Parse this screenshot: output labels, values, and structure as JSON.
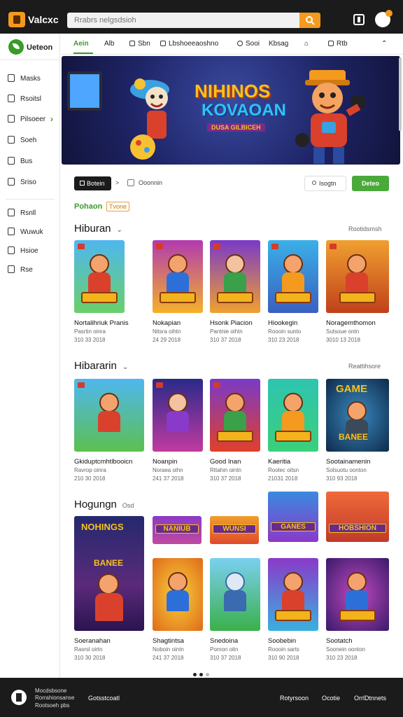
{
  "header": {
    "app_title": "Valcxc",
    "search_placeholder": "Rrabrs nelgsdsioh"
  },
  "sidebar": {
    "brand": "Ueteon",
    "items": [
      {
        "label": "Masks"
      },
      {
        "label": "Rsoitsl"
      },
      {
        "label": "Pilsoeer"
      },
      {
        "label": "Soeh"
      },
      {
        "label": "Bus"
      },
      {
        "label": "Sriso"
      },
      {
        "label": "Rsnll"
      },
      {
        "label": "Wuwuk"
      },
      {
        "label": "Hsioe"
      },
      {
        "label": "Rse"
      }
    ]
  },
  "nav": {
    "items": [
      {
        "label": "Aein",
        "active": true
      },
      {
        "label": "Alb"
      },
      {
        "label": "Sbn"
      },
      {
        "label": "Lbshoeeaoshno"
      },
      {
        "label": "Sooi"
      },
      {
        "label": "Kbsag"
      },
      {
        "label": "Rtb"
      }
    ]
  },
  "hero": {
    "title_line1": "NIHINOS",
    "title_line2": "KOVAOAN",
    "subtitle": "DUSA GILBICEH"
  },
  "toolbar": {
    "filter_label": "Botein",
    "breadcrumb_sep": ">",
    "check_label": "Ooonnin",
    "sort_label": "Isogtn",
    "action_label": "Deteo"
  },
  "popular": {
    "label": "Pohaon",
    "tag": "Tvone"
  },
  "sections": [
    {
      "title": "Hiburan",
      "link": "Rootidsmsh",
      "cards": [
        {
          "title": "Nortalihriuk Pranis",
          "sub": "Pasrtin oinra",
          "date": "310 33 2018"
        },
        {
          "title": "Nokapian",
          "sub": "Nitsra oihtn",
          "date": "24 29 2018"
        },
        {
          "title": "Hsonk Piacion",
          "sub": "Pantnie oihtn",
          "date": "310 37 2018"
        },
        {
          "title": "Hiookegin",
          "sub": "Roooin sunto",
          "date": "310 23 2018"
        },
        {
          "title": "Noragemthomon",
          "sub": "Sutsoue ontn",
          "date": "3010 13 2018"
        }
      ]
    },
    {
      "title": "Hibararin",
      "link": "Reattihsore",
      "cards": [
        {
          "title": "Gkiduptcmhtlbooicn",
          "sub": "Ravrop oinra",
          "date": "210 30 2018"
        },
        {
          "title": "Noanpin",
          "sub": "Noraea oihn",
          "date": "241 37 2018"
        },
        {
          "title": "Good Inan",
          "sub": "Rttahin ointn",
          "date": "310 37 2018"
        },
        {
          "title": "Kaeritia",
          "sub": "Roolec oitsn",
          "date": "21031 2018"
        },
        {
          "title": "Sootainamenin",
          "sub": "Solsuotu oonton",
          "date": "310 93 2018"
        }
      ]
    },
    {
      "title": "Hogungn",
      "extra": "Osd",
      "banners": [
        {
          "label": "NANIUB"
        },
        {
          "label": "WUNSI"
        },
        {
          "label": "GANES"
        },
        {
          "label": "HOBSHION"
        }
      ],
      "cards": [
        {
          "title": "Soeranahan",
          "sub": "Rasrsl oirtn",
          "date": "310 30 2018"
        },
        {
          "title": "Shagtintsa",
          "sub": "Noboin ointn",
          "date": "241 37 2018"
        },
        {
          "title": "Snedoina",
          "sub": "Pomon oitn",
          "date": "310 37 2018"
        },
        {
          "title": "Soobebin",
          "sub": "Roooin sarts",
          "date": "310 90 2018"
        },
        {
          "title": "Sootatch",
          "sub": "Soonein oonton",
          "date": "310 23 2018"
        }
      ],
      "big_card": {
        "title_top": "NOHINGS",
        "title_mid": "BANEE"
      }
    }
  ],
  "footer": {
    "line1": "Mocdsbsone",
    "line2": "Rorrahionsanse",
    "line3": "Rootsoeh pbs",
    "center": "Gotsstcoatl",
    "links": [
      "Rotyrsoon",
      "Ocotie",
      "OrrlDtnnets"
    ]
  }
}
